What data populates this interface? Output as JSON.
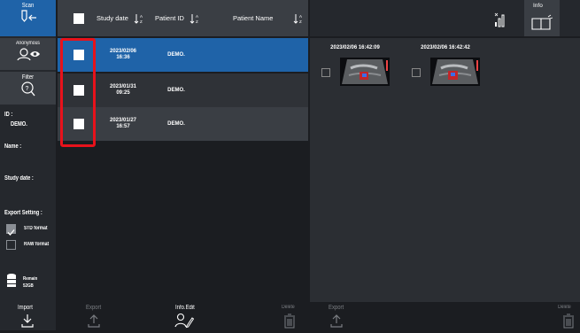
{
  "sidebar": {
    "scan_label": "Scan",
    "anonymous_label": "Anonymous",
    "filter_label": "Filter",
    "id_label": "ID :",
    "id_value": "DEMO.",
    "name_label": "Name :",
    "study_date_label": "Study date :",
    "export_setting_label": "Export Setting :",
    "std_format_label": "STD format",
    "raw_format_label": "RAW format",
    "std_format_checked": true,
    "raw_format_checked": false,
    "remain_label": "Remain",
    "remain_value": "52GB"
  },
  "table": {
    "headers": {
      "study_date": "Study date",
      "patient_id": "Patient ID",
      "patient_name": "Patient Name"
    },
    "rows": [
      {
        "date": "2023/02/06",
        "time": "16:36",
        "patient_id": "DEMO.",
        "patient_name": "",
        "selected": true
      },
      {
        "date": "2023/01/31",
        "time": "09:25",
        "patient_id": "DEMO.",
        "patient_name": "",
        "selected": false
      },
      {
        "date": "2023/01/27",
        "time": "16:57",
        "patient_id": "DEMO.",
        "patient_name": "",
        "selected": false
      }
    ]
  },
  "topbar": {
    "info_label": "Info"
  },
  "thumbnails": [
    {
      "timestamp": "2023/02/06 16:42:09"
    },
    {
      "timestamp": "2023/02/06 16:42:42"
    }
  ],
  "bottombar": {
    "import_label": "Import",
    "export_label": "Export",
    "info_edit_label": "Info.Edit",
    "delete_label": "Delete",
    "export_right_label": "Export",
    "delete_right_label": "Delete"
  },
  "colors": {
    "accent_blue": "#1f63a8",
    "highlight_red": "#e8121b",
    "panel_gray": "#3a3e44"
  }
}
